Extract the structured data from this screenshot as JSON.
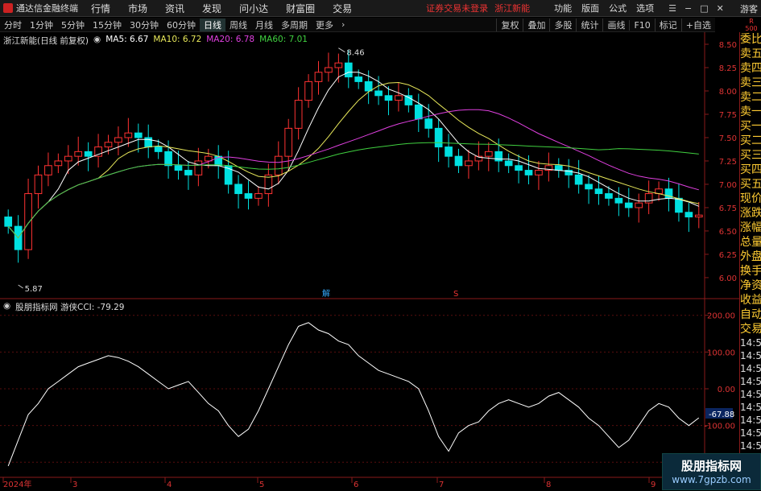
{
  "app": {
    "title": "通达信金融终端",
    "menus": [
      "行情",
      "市场",
      "资讯",
      "发现",
      "问小达",
      "财富圈",
      "交易"
    ],
    "status": "证券交易未登录",
    "stock": "浙江新能",
    "tools": [
      "功能",
      "版面",
      "公式",
      "选项"
    ],
    "guest": "游客"
  },
  "periods": [
    "分时",
    "1分钟",
    "5分钟",
    "15分钟",
    "30分钟",
    "60分钟",
    "日线",
    "周线",
    "月线",
    "多周期",
    "更多"
  ],
  "active_period": "日线",
  "right_tools": [
    "复权",
    "叠加",
    "多股",
    "统计",
    "画线",
    "F10",
    "标记",
    "+自选"
  ],
  "r_badge": {
    "top": "R",
    "bottom": "500"
  },
  "price_panel": {
    "title": "浙江新能(日线 前复权)",
    "ma": [
      {
        "label": "MA5: 6.67",
        "color": "#ffffff"
      },
      {
        "label": "MA10: 6.72",
        "color": "#e8e85a"
      },
      {
        "label": "MA20: 6.78",
        "color": "#e040e0"
      },
      {
        "label": "MA60: 7.01",
        "color": "#40d040"
      }
    ],
    "high_label": "8.46",
    "low_label": "5.87",
    "y_ticks": [
      "8.50",
      "8.25",
      "8.00",
      "7.75",
      "7.50",
      "7.25",
      "7.00",
      "6.75",
      "6.50",
      "6.25",
      "6.00"
    ],
    "markers": [
      {
        "text": "解",
        "color": "#3af"
      },
      {
        "text": "S",
        "color": "#e33"
      }
    ]
  },
  "cci_panel": {
    "title": "股朋指标网 游侠CCI: -79.29",
    "y_ticks": [
      "200.00",
      "100.00",
      "0.00",
      "-100.00",
      "-200.00"
    ],
    "current": "-67.88"
  },
  "x_axis": [
    "2024年",
    "3",
    "4",
    "5",
    "6",
    "7",
    "8",
    "9"
  ],
  "side_labels": [
    "委比",
    "卖五",
    "卖四",
    "卖三",
    "卖二",
    "卖一",
    "买一",
    "买二",
    "买三",
    "买四",
    "买五",
    "现价",
    "涨跌",
    "涨幅",
    "总量",
    "外盘",
    "换手",
    "净资",
    "收益",
    "自动",
    "交易"
  ],
  "side_times": [
    "14:56",
    "14:56",
    "14:56",
    "14:56",
    "14:56",
    "14:56",
    "14:56",
    "14:56",
    "14:56",
    "14:56",
    "14:56",
    "14:56"
  ],
  "watermark": {
    "line1": "股朋指标网",
    "line2": "www.7gpzb.com"
  },
  "chart_data": {
    "type": "candlestick",
    "price_axis_range": [
      5.87,
      8.5
    ],
    "cci_axis_range": [
      -230,
      230
    ],
    "close_series": [
      6.55,
      6.3,
      6.9,
      7.1,
      7.2,
      7.25,
      7.3,
      7.35,
      7.3,
      7.4,
      7.45,
      7.5,
      7.55,
      7.5,
      7.4,
      7.35,
      7.2,
      7.15,
      7.1,
      7.25,
      7.3,
      7.2,
      7.0,
      6.9,
      6.85,
      6.9,
      7.1,
      7.3,
      7.6,
      7.9,
      8.1,
      8.2,
      8.25,
      8.3,
      8.15,
      8.1,
      8.0,
      7.95,
      7.9,
      7.95,
      7.85,
      7.7,
      7.6,
      7.4,
      7.3,
      7.2,
      7.25,
      7.3,
      7.35,
      7.25,
      7.2,
      7.15,
      7.1,
      7.15,
      7.2,
      7.15,
      7.1,
      7.0,
      6.95,
      6.9,
      6.85,
      6.8,
      6.75,
      6.8,
      6.9,
      6.95,
      6.85,
      6.7,
      6.65,
      6.67
    ],
    "cci_series": [
      -210,
      -140,
      -70,
      -40,
      0,
      20,
      40,
      60,
      70,
      80,
      90,
      85,
      75,
      60,
      40,
      20,
      0,
      10,
      20,
      -10,
      -40,
      -60,
      -100,
      -130,
      -110,
      -60,
      0,
      60,
      120,
      170,
      180,
      160,
      150,
      130,
      120,
      90,
      70,
      50,
      40,
      30,
      20,
      0,
      -60,
      -130,
      -170,
      -120,
      -100,
      -90,
      -60,
      -40,
      -30,
      -40,
      -50,
      -40,
      -20,
      -10,
      -30,
      -50,
      -80,
      -100,
      -130,
      -160,
      -140,
      -100,
      -60,
      -40,
      -50,
      -80,
      -100,
      -79
    ]
  }
}
